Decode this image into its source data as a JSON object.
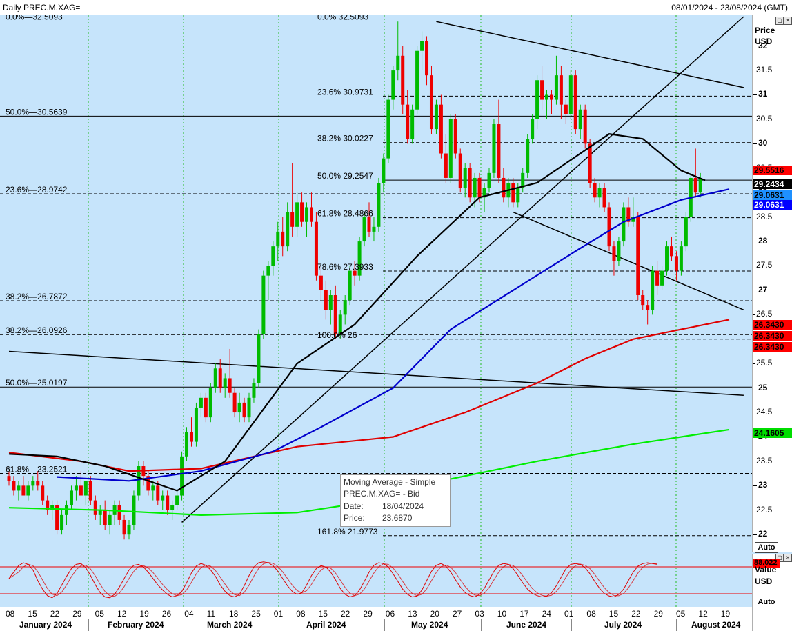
{
  "header": {
    "title": "Daily PREC.M.XAG=",
    "date_range": "08/01/2024 - 23/08/2024 (GMT)"
  },
  "price_axis": {
    "title": "Price",
    "unit": "USD",
    "ticks": [
      "32",
      "31.5",
      "31",
      "30.5",
      "30",
      "29.5",
      "29",
      "28.5",
      "28",
      "27.5",
      "27",
      "26.5",
      "26",
      "25.5",
      "25",
      "24.5",
      "24",
      "23.5",
      "23",
      "22.5",
      "22"
    ],
    "auto_label": "Auto"
  },
  "osc_axis": {
    "title": "Value",
    "unit": "USD",
    "auto_label": "Auto"
  },
  "price_badges": [
    {
      "value": "29.5516",
      "color": "#ff0000"
    },
    {
      "value": "29.2434",
      "color": "#000000"
    },
    {
      "value": "29.0631",
      "color": "#1e90ff"
    },
    {
      "value": "29.0631",
      "color": "#0000ff"
    },
    {
      "value": "26.3430",
      "color": "#ff0000"
    },
    {
      "value": "26.3430",
      "color": "#ff0000"
    },
    {
      "value": "26.3430",
      "color": "#ff0000"
    },
    {
      "value": "24.1605",
      "color": "#00dd00"
    }
  ],
  "osc_badge": {
    "value": "88.022",
    "color": "#ff0000"
  },
  "tooltip": {
    "title": "Moving Average - Simple",
    "instrument": "PREC.M.XAG= - Bid",
    "date_label": "Date:",
    "date_value": "18/04/2024",
    "price_label": "Price:",
    "price_value": "23.6870"
  },
  "date_axis": {
    "days": [
      "08",
      "15",
      "22",
      "29",
      "05",
      "12",
      "19",
      "26",
      "04",
      "11",
      "18",
      "25",
      "01",
      "08",
      "15",
      "22",
      "29",
      "06",
      "13",
      "20",
      "27",
      "03",
      "10",
      "17",
      "24",
      "01",
      "08",
      "15",
      "22",
      "29",
      "05",
      "12",
      "19"
    ],
    "months": [
      "January 2024",
      "February 2024",
      "March 2024",
      "April 2024",
      "May 2024",
      "June 2024",
      "July 2024",
      "August 2024"
    ]
  },
  "fib_labels": [
    {
      "text": "0.0%",
      "value": "32.5093",
      "price": 32.5093,
      "side": "left"
    },
    {
      "text": "50.0%",
      "value": "30.5639",
      "price": 30.5639,
      "side": "left"
    },
    {
      "text": "23.6%",
      "value": "28.9742",
      "price": 28.9742,
      "side": "left"
    },
    {
      "text": "38.2%",
      "value": "26.7872",
      "price": 26.7872,
      "side": "left"
    },
    {
      "text": "38.2%",
      "value": "26.0926",
      "price": 26.0926,
      "side": "left"
    },
    {
      "text": "50.0%",
      "value": "25.0197",
      "price": 25.0197,
      "side": "left"
    },
    {
      "text": "61.8%",
      "value": "23.2521",
      "price": 23.2521,
      "side": "left"
    },
    {
      "text": "0.0%",
      "value": "32.5093",
      "price": 32.5093,
      "side": "mid"
    },
    {
      "text": "23.6%",
      "value": "30.9731",
      "price": 30.9731,
      "side": "mid"
    },
    {
      "text": "38.2%",
      "value": "30.0227",
      "price": 30.0227,
      "side": "mid"
    },
    {
      "text": "50.0%",
      "value": "29.2547",
      "price": 29.2547,
      "side": "mid"
    },
    {
      "text": "61.8%",
      "value": "28.4866",
      "price": 28.4866,
      "side": "mid"
    },
    {
      "text": "78.6%",
      "value": "27.3933",
      "price": 27.3933,
      "side": "mid"
    },
    {
      "text": "100.0%",
      "value": "26",
      "price": 26.0,
      "side": "mid"
    },
    {
      "text": "161.8%",
      "value": "21.9773",
      "price": 21.9773,
      "side": "mid"
    }
  ],
  "chart_data": {
    "type": "candlestick",
    "ylim": [
      21.65,
      32.63
    ],
    "grid": "vertical dotted green lines at month starts",
    "candles": [
      [
        23.2,
        23.3,
        23.0,
        23.1
      ],
      [
        23.1,
        23.2,
        22.8,
        22.9
      ],
      [
        22.9,
        23.1,
        22.7,
        23.0
      ],
      [
        23.0,
        23.2,
        22.8,
        22.8
      ],
      [
        22.8,
        23.1,
        22.7,
        23.0
      ],
      [
        23.0,
        23.2,
        22.9,
        23.1
      ],
      [
        23.1,
        23.3,
        22.9,
        23.0
      ],
      [
        23.0,
        23.1,
        22.6,
        22.7
      ],
      [
        22.7,
        22.8,
        22.4,
        22.5
      ],
      [
        22.5,
        22.7,
        22.3,
        22.6
      ],
      [
        22.6,
        22.7,
        22.0,
        22.1
      ],
      [
        22.1,
        22.5,
        22.0,
        22.4
      ],
      [
        22.4,
        22.7,
        22.2,
        22.6
      ],
      [
        22.6,
        23.0,
        22.5,
        22.9
      ],
      [
        22.9,
        23.2,
        22.7,
        23.0
      ],
      [
        23.0,
        23.3,
        22.8,
        22.8
      ],
      [
        22.8,
        23.1,
        22.6,
        23.1
      ],
      [
        23.1,
        23.2,
        22.6,
        22.7
      ],
      [
        22.7,
        22.8,
        22.3,
        22.4
      ],
      [
        22.4,
        22.6,
        22.2,
        22.5
      ],
      [
        22.5,
        22.7,
        22.1,
        22.2
      ],
      [
        22.2,
        22.5,
        22.0,
        22.4
      ],
      [
        22.4,
        22.7,
        22.2,
        22.6
      ],
      [
        22.6,
        22.7,
        22.2,
        22.3
      ],
      [
        22.3,
        22.4,
        21.9,
        22.0
      ],
      [
        22.0,
        22.3,
        21.9,
        22.2
      ],
      [
        22.2,
        22.9,
        22.1,
        22.8
      ],
      [
        22.8,
        23.5,
        22.7,
        23.4
      ],
      [
        23.4,
        23.5,
        23.0,
        23.2
      ],
      [
        23.2,
        23.3,
        22.8,
        22.9
      ],
      [
        22.9,
        23.1,
        22.7,
        23.0
      ],
      [
        23.0,
        23.1,
        22.6,
        22.7
      ],
      [
        22.7,
        22.9,
        22.5,
        22.8
      ],
      [
        22.8,
        22.9,
        22.4,
        22.5
      ],
      [
        22.5,
        22.7,
        22.3,
        22.6
      ],
      [
        22.6,
        22.9,
        22.5,
        22.8
      ],
      [
        22.8,
        23.7,
        22.7,
        23.6
      ],
      [
        23.6,
        24.2,
        23.5,
        24.1
      ],
      [
        24.1,
        24.4,
        23.8,
        23.9
      ],
      [
        23.9,
        24.7,
        23.8,
        24.6
      ],
      [
        24.6,
        24.9,
        24.4,
        24.8
      ],
      [
        24.8,
        24.9,
        24.3,
        24.4
      ],
      [
        24.4,
        25.1,
        24.3,
        25.0
      ],
      [
        25.0,
        25.5,
        24.9,
        25.4
      ],
      [
        25.4,
        25.6,
        24.9,
        25.0
      ],
      [
        25.0,
        25.3,
        24.8,
        25.2
      ],
      [
        25.2,
        25.8,
        24.8,
        24.9
      ],
      [
        24.9,
        25.0,
        24.4,
        24.5
      ],
      [
        24.5,
        24.9,
        24.3,
        24.7
      ],
      [
        24.7,
        24.8,
        24.3,
        24.4
      ],
      [
        24.4,
        24.9,
        24.3,
        24.8
      ],
      [
        24.8,
        25.2,
        24.7,
        25.1
      ],
      [
        25.1,
        26.2,
        25.0,
        26.1
      ],
      [
        26.1,
        27.4,
        26.0,
        27.3
      ],
      [
        27.3,
        27.6,
        26.8,
        27.5
      ],
      [
        27.5,
        28.0,
        27.3,
        27.9
      ],
      [
        27.9,
        28.4,
        27.6,
        28.2
      ],
      [
        28.2,
        28.5,
        27.7,
        27.9
      ],
      [
        27.9,
        28.8,
        27.8,
        28.6
      ],
      [
        28.6,
        29.6,
        28.1,
        28.3
      ],
      [
        28.3,
        29.0,
        28.1,
        28.8
      ],
      [
        28.8,
        29.0,
        28.3,
        28.4
      ],
      [
        28.4,
        28.8,
        28.1,
        28.7
      ],
      [
        28.7,
        29.0,
        28.3,
        28.4
      ],
      [
        28.4,
        28.6,
        27.2,
        27.3
      ],
      [
        27.3,
        27.5,
        26.8,
        27.0
      ],
      [
        27.0,
        27.2,
        26.4,
        26.6
      ],
      [
        26.6,
        27.0,
        26.3,
        26.9
      ],
      [
        26.9,
        27.1,
        26.0,
        26.1
      ],
      [
        26.1,
        26.6,
        26.0,
        26.5
      ],
      [
        26.5,
        26.9,
        26.3,
        26.8
      ],
      [
        26.8,
        27.5,
        26.7,
        27.4
      ],
      [
        27.4,
        27.6,
        27.1,
        27.3
      ],
      [
        27.3,
        28.1,
        27.2,
        28.0
      ],
      [
        28.0,
        28.6,
        27.9,
        28.5
      ],
      [
        28.5,
        28.8,
        28.1,
        28.2
      ],
      [
        28.2,
        28.5,
        28.0,
        28.3
      ],
      [
        28.3,
        29.3,
        28.2,
        29.2
      ],
      [
        29.2,
        29.8,
        29.0,
        29.7
      ],
      [
        29.7,
        31.0,
        29.6,
        30.9
      ],
      [
        30.9,
        31.6,
        30.7,
        31.5
      ],
      [
        31.5,
        32.5,
        31.3,
        31.8
      ],
      [
        31.8,
        32.0,
        30.6,
        30.8
      ],
      [
        30.8,
        31.1,
        30.0,
        30.1
      ],
      [
        30.1,
        30.8,
        30.0,
        30.7
      ],
      [
        30.7,
        32.0,
        30.6,
        31.9
      ],
      [
        31.9,
        32.3,
        31.5,
        32.1
      ],
      [
        32.1,
        32.2,
        31.2,
        31.4
      ],
      [
        31.4,
        31.6,
        30.2,
        30.3
      ],
      [
        30.3,
        30.9,
        30.2,
        30.8
      ],
      [
        30.8,
        31.0,
        29.7,
        29.8
      ],
      [
        29.8,
        30.2,
        29.2,
        29.3
      ],
      [
        29.3,
        30.6,
        29.2,
        30.5
      ],
      [
        30.5,
        30.6,
        29.7,
        29.8
      ],
      [
        29.8,
        29.9,
        29.0,
        29.1
      ],
      [
        29.1,
        29.6,
        28.9,
        29.5
      ],
      [
        29.5,
        29.6,
        28.8,
        28.9
      ],
      [
        28.9,
        29.4,
        28.7,
        29.3
      ],
      [
        29.3,
        29.4,
        28.8,
        28.9
      ],
      [
        28.9,
        29.2,
        28.6,
        29.1
      ],
      [
        29.1,
        29.5,
        29.0,
        29.4
      ],
      [
        29.4,
        30.5,
        29.3,
        30.4
      ],
      [
        30.4,
        30.9,
        29.2,
        29.3
      ],
      [
        29.3,
        29.5,
        28.8,
        28.9
      ],
      [
        28.9,
        29.3,
        28.7,
        29.2
      ],
      [
        29.2,
        29.3,
        28.7,
        28.8
      ],
      [
        28.8,
        29.2,
        28.7,
        29.1
      ],
      [
        29.1,
        29.5,
        29.0,
        29.4
      ],
      [
        29.4,
        30.2,
        29.3,
        30.1
      ],
      [
        30.1,
        30.6,
        30.0,
        30.5
      ],
      [
        30.5,
        31.4,
        30.3,
        31.3
      ],
      [
        31.3,
        31.6,
        30.7,
        30.9
      ],
      [
        30.9,
        31.1,
        30.5,
        31.0
      ],
      [
        31.0,
        31.1,
        30.6,
        30.9
      ],
      [
        30.9,
        31.8,
        30.8,
        31.4
      ],
      [
        31.4,
        31.6,
        30.5,
        30.8
      ],
      [
        30.8,
        30.9,
        30.4,
        30.6
      ],
      [
        30.6,
        31.5,
        30.5,
        31.4
      ],
      [
        31.4,
        31.5,
        30.2,
        30.3
      ],
      [
        30.3,
        30.8,
        30.1,
        30.7
      ],
      [
        30.7,
        30.8,
        29.9,
        30.0
      ],
      [
        30.0,
        30.1,
        29.1,
        29.2
      ],
      [
        29.2,
        29.3,
        28.8,
        28.9
      ],
      [
        28.9,
        29.2,
        28.7,
        29.1
      ],
      [
        29.1,
        29.2,
        28.6,
        28.7
      ],
      [
        28.7,
        28.8,
        27.8,
        27.9
      ],
      [
        27.9,
        28.0,
        27.3,
        27.6
      ],
      [
        27.6,
        28.1,
        27.5,
        28.0
      ],
      [
        28.0,
        28.8,
        27.9,
        28.7
      ],
      [
        28.7,
        28.9,
        28.3,
        28.4
      ],
      [
        28.4,
        28.9,
        28.3,
        28.5
      ],
      [
        28.5,
        28.6,
        26.8,
        26.9
      ],
      [
        26.9,
        27.0,
        26.6,
        26.7
      ],
      [
        26.7,
        26.8,
        26.3,
        26.6
      ],
      [
        26.6,
        27.5,
        26.5,
        27.4
      ],
      [
        27.4,
        27.6,
        26.9,
        27.1
      ],
      [
        27.1,
        27.5,
        27.0,
        27.4
      ],
      [
        27.4,
        28.0,
        27.3,
        27.9
      ],
      [
        27.9,
        28.1,
        27.6,
        27.7
      ],
      [
        27.7,
        27.8,
        27.2,
        27.4
      ],
      [
        27.4,
        28.0,
        27.3,
        27.9
      ],
      [
        27.9,
        28.6,
        27.8,
        28.5
      ],
      [
        28.5,
        29.4,
        28.4,
        29.3
      ],
      [
        29.3,
        29.9,
        28.9,
        29.0
      ],
      [
        29.0,
        29.4,
        28.9,
        29.3
      ]
    ],
    "moving_averages": [
      {
        "color": "#00ee00",
        "points": [
          [
            0,
            22.55
          ],
          [
            20,
            22.5
          ],
          [
            40,
            22.4
          ],
          [
            60,
            22.45
          ],
          [
            70,
            22.6
          ],
          [
            90,
            23.1
          ],
          [
            110,
            23.5
          ],
          [
            130,
            23.85
          ],
          [
            150,
            24.15
          ]
        ]
      },
      {
        "color": "#e00000",
        "points": [
          [
            0,
            23.68
          ],
          [
            15,
            23.5
          ],
          [
            25,
            23.3
          ],
          [
            40,
            23.35
          ],
          [
            60,
            23.8
          ],
          [
            80,
            24.0
          ],
          [
            95,
            24.5
          ],
          [
            110,
            25.1
          ],
          [
            120,
            25.6
          ],
          [
            130,
            26.0
          ],
          [
            140,
            26.2
          ],
          [
            150,
            26.4
          ]
        ]
      },
      {
        "color": "#0000cc",
        "points": [
          [
            10,
            23.18
          ],
          [
            25,
            23.1
          ],
          [
            40,
            23.3
          ],
          [
            55,
            23.7
          ],
          [
            65,
            24.2
          ],
          [
            80,
            25.0
          ],
          [
            92,
            26.2
          ],
          [
            105,
            27.0
          ],
          [
            118,
            27.8
          ],
          [
            128,
            28.4
          ],
          [
            140,
            28.85
          ],
          [
            150,
            29.07
          ]
        ]
      },
      {
        "color": "#000000",
        "points": [
          [
            0,
            23.65
          ],
          [
            10,
            23.6
          ],
          [
            20,
            23.4
          ],
          [
            35,
            22.9
          ],
          [
            45,
            23.5
          ],
          [
            60,
            25.5
          ],
          [
            72,
            26.3
          ],
          [
            85,
            27.7
          ],
          [
            98,
            28.9
          ],
          [
            110,
            29.2
          ],
          [
            125,
            30.2
          ],
          [
            132,
            30.1
          ],
          [
            140,
            29.45
          ],
          [
            145,
            29.25
          ]
        ]
      }
    ],
    "trendlines": [
      [
        [
          0,
          25.75
        ],
        [
          153,
          24.85
        ]
      ],
      [
        [
          36,
          22.25
        ],
        [
          153,
          32.6
        ]
      ],
      [
        [
          89,
          32.5
        ],
        [
          153,
          31.15
        ]
      ],
      [
        [
          105,
          28.6
        ],
        [
          153,
          26.6
        ]
      ]
    ],
    "oscillator": {
      "fast_color": "#e00000",
      "slow_color": "#e00000",
      "upper_level": "80",
      "lower_level": "20",
      "fast": [
        55,
        70,
        85,
        92,
        88,
        75,
        50,
        30,
        15,
        10,
        20,
        40,
        60,
        78,
        88,
        90,
        80,
        62,
        40,
        22,
        12,
        10,
        18,
        35,
        55,
        75,
        86,
        88,
        82,
        70,
        55,
        40,
        28,
        18,
        12,
        15,
        25,
        45,
        68,
        84,
        90,
        86,
        75,
        60,
        40,
        25,
        15,
        12,
        18,
        38,
        62,
        82,
        92,
        94,
        92,
        85,
        72,
        55,
        38,
        25,
        18,
        22,
        40,
        62,
        78,
        85,
        82,
        70,
        52,
        32,
        18,
        12,
        15,
        28,
        48,
        70,
        86,
        92,
        90,
        82,
        66,
        48,
        30,
        18,
        12,
        14,
        28,
        50,
        72,
        86,
        90,
        84,
        70,
        52,
        35,
        22,
        15,
        12,
        18,
        32,
        52,
        72,
        86,
        90,
        88,
        78,
        62,
        45,
        30,
        20,
        15,
        12,
        14,
        22,
        38,
        58,
        78,
        88,
        90,
        88,
        80,
        66,
        48,
        32,
        20,
        14,
        12,
        18,
        30,
        50,
        70,
        84,
        90,
        92,
        90,
        88
      ]
    }
  }
}
